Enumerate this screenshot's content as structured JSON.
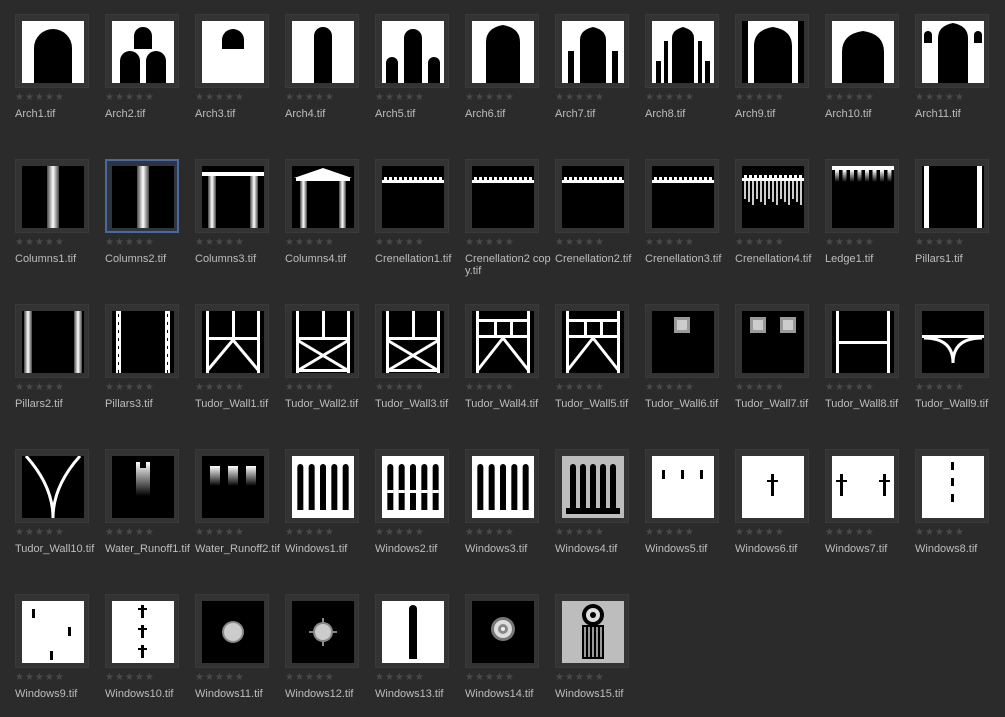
{
  "rating_glyphs": "★★★★★",
  "colors": {
    "background": "#2b2b2b",
    "label": "#bdbdbd",
    "selection": "#4a6a9e"
  },
  "selected_item": "Columns2.tif",
  "files": [
    {
      "name": "Arch1.tif",
      "icon": "arch-single-icon"
    },
    {
      "name": "Arch2.tif",
      "icon": "arch-triple-icon"
    },
    {
      "name": "Arch3.tif",
      "icon": "arch-small-icon"
    },
    {
      "name": "Arch4.tif",
      "icon": "arch-narrow-icon"
    },
    {
      "name": "Arch5.tif",
      "icon": "arch-tall-triple-icon"
    },
    {
      "name": "Arch6.tif",
      "icon": "arch-ornate-icon"
    },
    {
      "name": "Arch7.tif",
      "icon": "arch-columned-icon"
    },
    {
      "name": "Arch8.tif",
      "icon": "arch-pillared-icon"
    },
    {
      "name": "Arch9.tif",
      "icon": "arch-moorish-icon"
    },
    {
      "name": "Arch10.tif",
      "icon": "arch-moorish-wide-icon"
    },
    {
      "name": "Arch11.tif",
      "icon": "arch-moorish-triple-icon"
    },
    {
      "name": "Columns1.tif",
      "icon": "column-single-icon"
    },
    {
      "name": "Columns2.tif",
      "icon": "column-single-icon"
    },
    {
      "name": "Columns3.tif",
      "icon": "column-pair-icon"
    },
    {
      "name": "Columns4.tif",
      "icon": "column-pediment-icon"
    },
    {
      "name": "Crenellation1.tif",
      "icon": "crenellation-icon"
    },
    {
      "name": "Crenellation2 copy.tif",
      "icon": "crenellation-icon"
    },
    {
      "name": "Crenellation2.tif",
      "icon": "crenellation-icon"
    },
    {
      "name": "Crenellation3.tif",
      "icon": "crenellation-icon"
    },
    {
      "name": "Crenellation4.tif",
      "icon": "crenellation-fringe-icon"
    },
    {
      "name": "Ledge1.tif",
      "icon": "ledge-icon"
    },
    {
      "name": "Pillars1.tif",
      "icon": "pillars-edge-icon"
    },
    {
      "name": "Pillars2.tif",
      "icon": "pillars-gradient-icon"
    },
    {
      "name": "Pillars3.tif",
      "icon": "pillars-dashed-icon"
    },
    {
      "name": "Tudor_Wall1.tif",
      "icon": "tudor-wall-icon"
    },
    {
      "name": "Tudor_Wall2.tif",
      "icon": "tudor-wall-cross-icon"
    },
    {
      "name": "Tudor_Wall3.tif",
      "icon": "tudor-wall-cross-icon"
    },
    {
      "name": "Tudor_Wall4.tif",
      "icon": "tudor-wall-grid-icon"
    },
    {
      "name": "Tudor_Wall5.tif",
      "icon": "tudor-wall-grid-icon"
    },
    {
      "name": "Tudor_Wall6.tif",
      "icon": "square-window-icon"
    },
    {
      "name": "Tudor_Wall7.tif",
      "icon": "double-square-window-icon"
    },
    {
      "name": "Tudor_Wall8.tif",
      "icon": "frame-beam-icon"
    },
    {
      "name": "Tudor_Wall9.tif",
      "icon": "curved-brace-icon"
    },
    {
      "name": "Tudor_Wall10.tif",
      "icon": "y-brace-icon"
    },
    {
      "name": "Water_Runoff1.tif",
      "icon": "water-runoff-icon"
    },
    {
      "name": "Water_Runoff2.tif",
      "icon": "water-runoff-triple-icon"
    },
    {
      "name": "Windows1.tif",
      "icon": "lancet-windows-icon"
    },
    {
      "name": "Windows2.tif",
      "icon": "lancet-windows-split-icon"
    },
    {
      "name": "Windows3.tif",
      "icon": "lancet-windows-icon"
    },
    {
      "name": "Windows4.tif",
      "icon": "lancet-windows-grey-icon"
    },
    {
      "name": "Windows5.tif",
      "icon": "slit-windows-icon"
    },
    {
      "name": "Windows6.tif",
      "icon": "cross-slit-icon"
    },
    {
      "name": "Windows7.tif",
      "icon": "cross-slit-pair-icon"
    },
    {
      "name": "Windows8.tif",
      "icon": "vertical-slits-icon"
    },
    {
      "name": "Windows9.tif",
      "icon": "scattered-slits-icon"
    },
    {
      "name": "Windows10.tif",
      "icon": "cross-slit-stack-icon"
    },
    {
      "name": "Windows11.tif",
      "icon": "round-window-icon"
    },
    {
      "name": "Windows12.tif",
      "icon": "round-window-spiked-icon"
    },
    {
      "name": "Windows13.tif",
      "icon": "tall-slit-window-icon"
    },
    {
      "name": "Windows14.tif",
      "icon": "rose-window-icon"
    },
    {
      "name": "Windows15.tif",
      "icon": "rose-window-column-icon"
    }
  ]
}
